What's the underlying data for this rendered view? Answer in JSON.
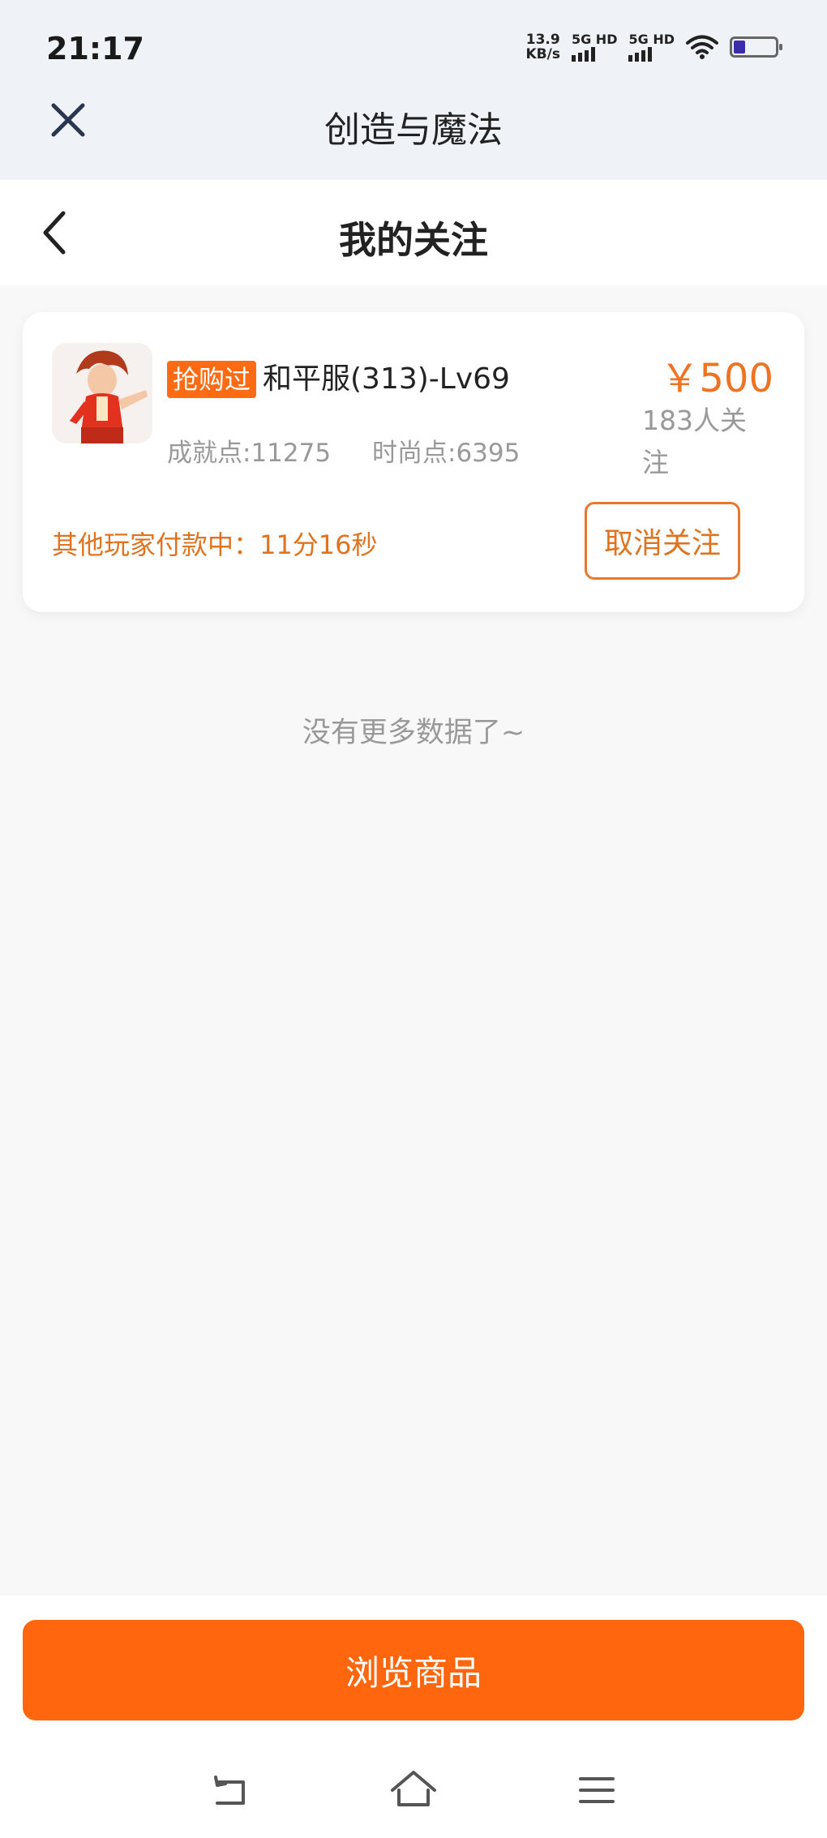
{
  "status_bar": {
    "time": "21:17",
    "net_speed_value": "13.9",
    "net_speed_unit": "KB/s",
    "sim1_label": "5G HD",
    "sim2_label": "5G HD",
    "wifi_icon": "wifi-icon",
    "battery_icon": "battery-icon"
  },
  "app_header": {
    "title": "创造与魔法",
    "close_icon": "close-icon"
  },
  "page_header": {
    "title": "我的关注",
    "back_icon": "chevron-left-icon"
  },
  "listing": {
    "tag": "抢购过",
    "name": "和平服(313)-Lv69",
    "achievement": "成就点:11275",
    "fashion": "时尚点:6395",
    "price": "￥500",
    "followers": "183人关注",
    "countdown": "其他玩家付款中：11分16秒",
    "unfollow_label": "取消关注"
  },
  "list_end_text": "没有更多数据了~",
  "browse_label": "浏览商品",
  "colors": {
    "accent": "#ff660e",
    "countdown": "#e0731f",
    "price": "#ee7424"
  }
}
